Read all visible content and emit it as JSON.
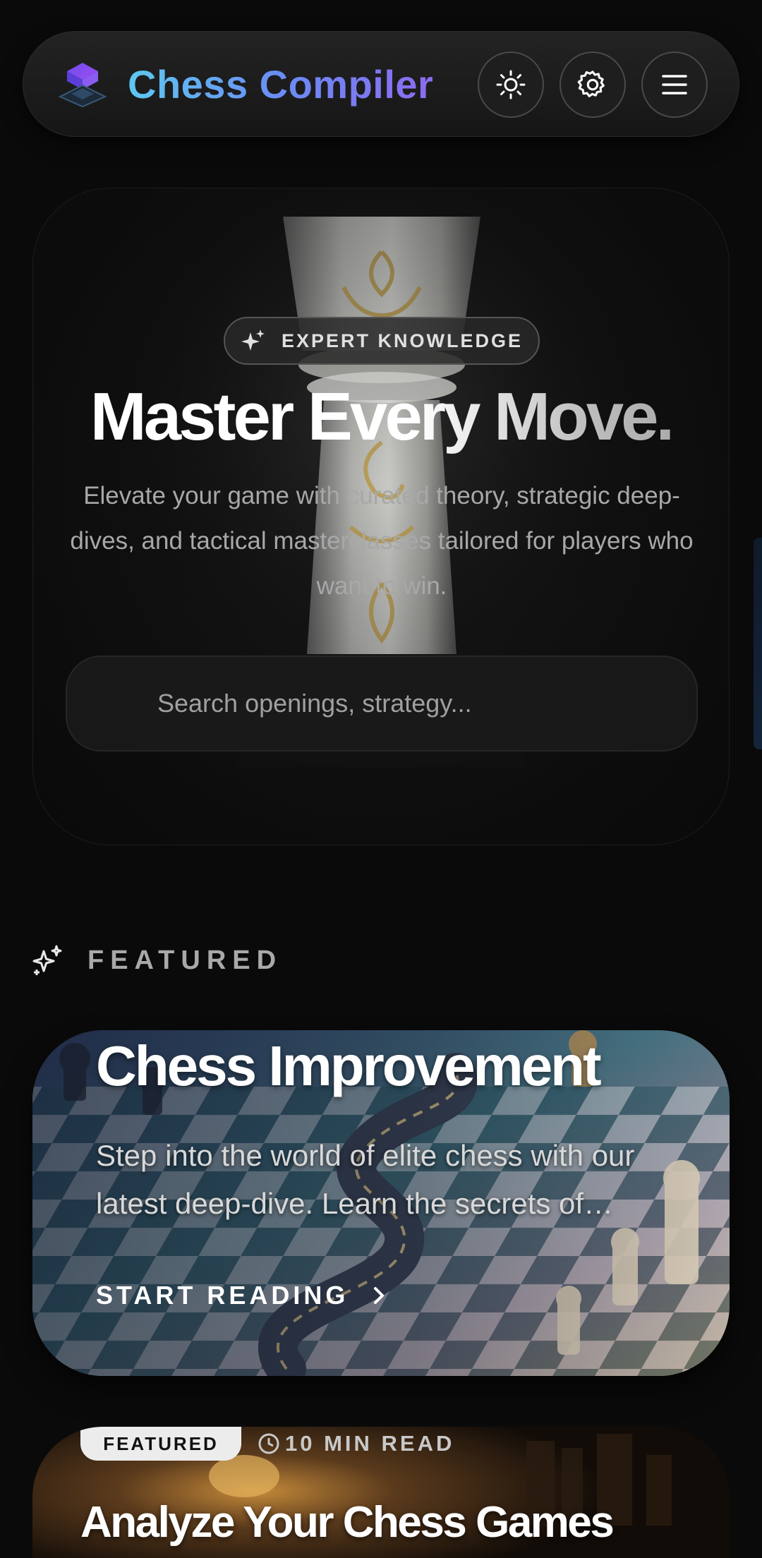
{
  "header": {
    "brand": "Chess Compiler",
    "logo_icon": "cube-logo-icon",
    "buttons": [
      {
        "icon": "sun-icon",
        "purpose": "theme-toggle"
      },
      {
        "icon": "gear-icon",
        "purpose": "settings"
      },
      {
        "icon": "hamburger-menu-icon",
        "purpose": "menu"
      }
    ]
  },
  "hero": {
    "badge": "EXPERT KNOWLEDGE",
    "badge_icon": "sparkle-icon",
    "title": "Master Every Move.",
    "subtitle": "Elevate your game with curated theory, strategic deep-dives, and tactical masterclasses tailored for players who want to win.",
    "search_placeholder": "Search openings, strategy..."
  },
  "section": {
    "icon": "sparkles-icon",
    "title": "FEATURED"
  },
  "featured_card": {
    "title": "Chess Improvement",
    "description": "Step into the world of elite chess with our latest deep-dive. Learn the secrets of improvement.",
    "cta": "START READING",
    "cta_icon": "chevron-right-icon"
  },
  "second_card": {
    "tag": "FEATURED",
    "read_time": "10 MIN READ",
    "read_time_icon": "clock-icon",
    "title": "Analyze Your Chess Games"
  },
  "colors": {
    "background": "#0a0a0a",
    "brand_gradient_start": "#5ec8f0",
    "brand_gradient_end": "#8b6cf0",
    "muted_text": "#a8a8a8"
  }
}
